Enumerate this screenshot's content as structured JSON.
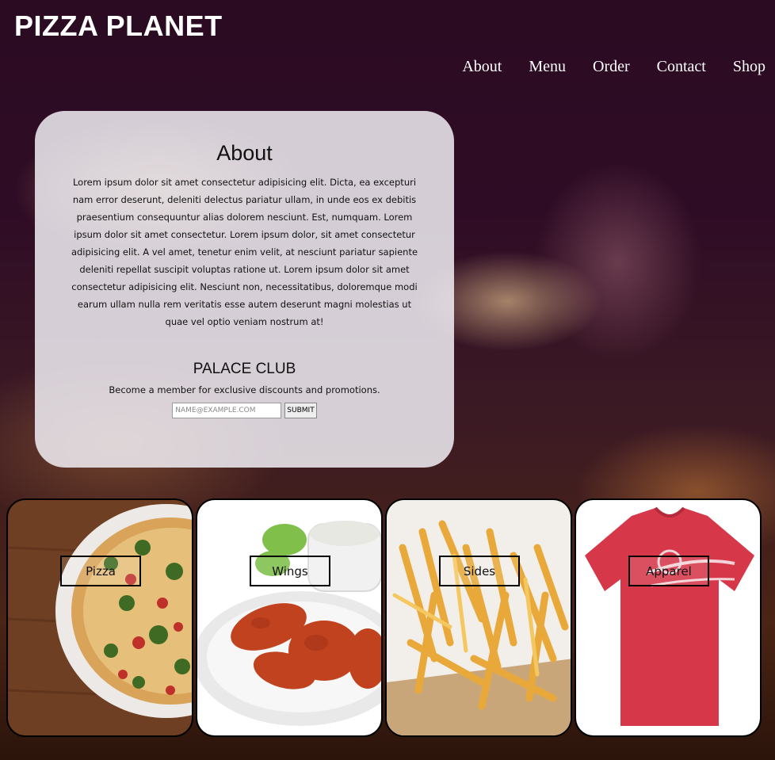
{
  "site": {
    "title": "PIZZA PLANET"
  },
  "nav": {
    "items": [
      {
        "label": "About"
      },
      {
        "label": "Menu"
      },
      {
        "label": "Order"
      },
      {
        "label": "Contact"
      },
      {
        "label": "Shop"
      }
    ]
  },
  "about": {
    "heading": "About",
    "body": "Lorem ipsum dolor sit amet consectetur adipisicing elit. Dicta, ea excepturi nam error deserunt, deleniti delectus pariatur ullam, in unde eos ex debitis praesentium consequuntur alias dolorem nesciunt. Est, numquam. Lorem ipsum dolor sit amet consectetur. Lorem ipsum dolor, sit amet consectetur adipisicing elit. A vel amet, tenetur enim velit, at nesciunt pariatur sapiente deleniti repellat suscipit voluptas ratione ut. Lorem ipsum dolor sit amet consectetur adipisicing elit. Nesciunt non, necessitatibus, doloremque modi earum ullam nulla rem veritatis esse autem deserunt magni molestias ut quae vel optio veniam nostrum at!"
  },
  "club": {
    "heading": "PALACE CLUB",
    "text": "Become a member for exclusive discounts and promotions.",
    "email_placeholder": "NAME@EXAMPLE.COM",
    "email_value": "",
    "submit_label": "SUBMIT"
  },
  "tiles": [
    {
      "label": "Pizza"
    },
    {
      "label": "Wings"
    },
    {
      "label": "Sides"
    },
    {
      "label": "Apparel"
    }
  ],
  "colors": {
    "text_white": "#ffffff",
    "card_bg": "#f0eef3",
    "background_dark": "#2f0c25",
    "shirt_red": "#d6384a"
  }
}
